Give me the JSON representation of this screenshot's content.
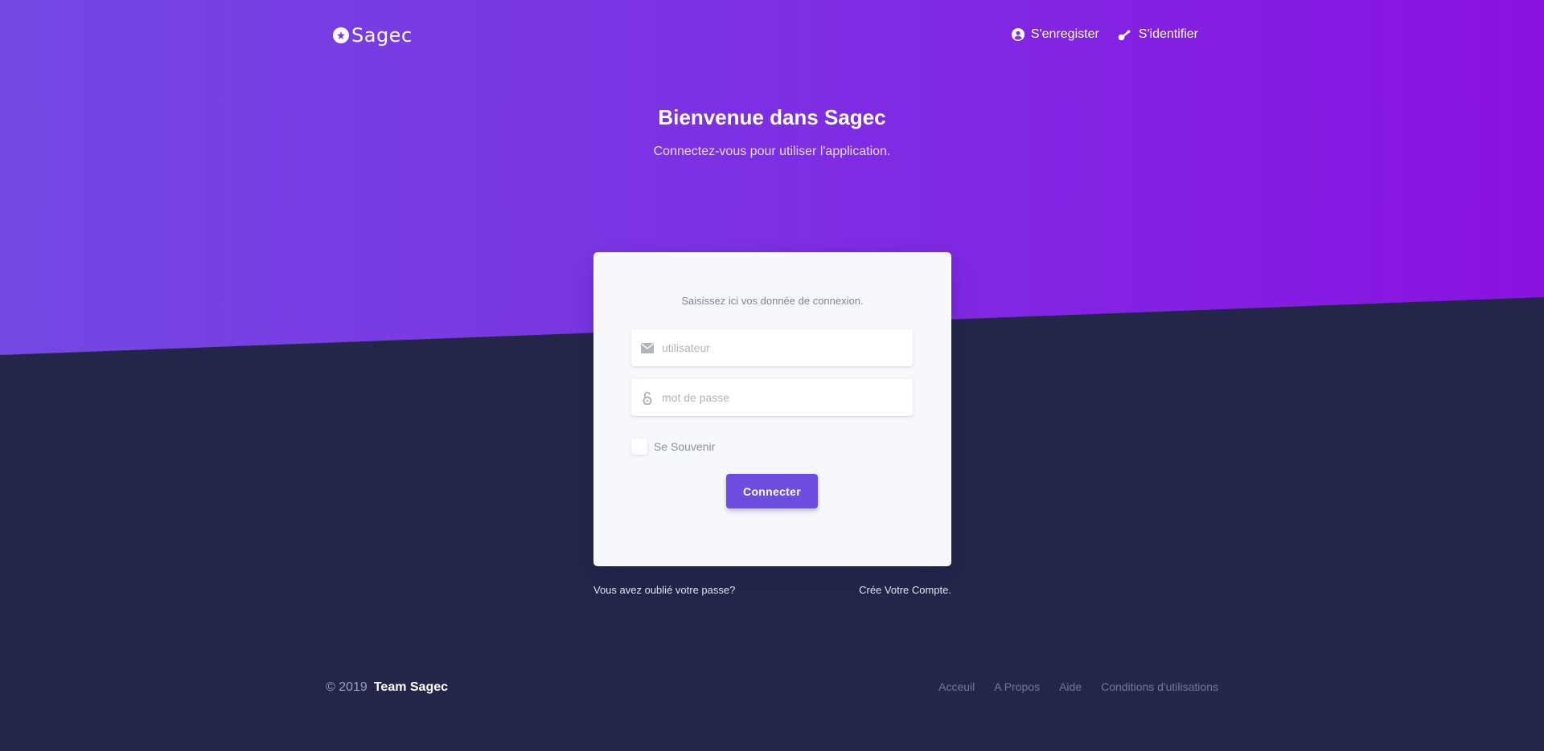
{
  "colors": {
    "hero_start": "#7448e3",
    "hero_end": "#8a12e2",
    "page_background": "#232649",
    "card_background": "#f6f8fb",
    "primary_button": "#6d4de0"
  },
  "navbar": {
    "brand": "Sagec",
    "brand_icon": "star-badge-icon",
    "links": [
      {
        "label": "S'enregister",
        "icon": "user-circle-icon"
      },
      {
        "label": "S'identifier",
        "icon": "key-icon"
      }
    ]
  },
  "hero": {
    "title": "Bienvenue dans Sagec",
    "subtitle": "Connectez-vous pour utiliser l'application."
  },
  "login_card": {
    "hint": "Saisissez ici vos donnée de connexion.",
    "username": {
      "placeholder": "utilisateur",
      "value": "",
      "icon": "envelope-icon"
    },
    "password": {
      "placeholder": "mot de passe",
      "value": "",
      "icon": "lock-open-icon"
    },
    "remember_label": "Se Souvenir",
    "remember_checked": false,
    "submit_label": "Connecter"
  },
  "below_card": {
    "forgot": "Vous avez oublié votre passe?",
    "create": "Crée Votre Compte."
  },
  "footer": {
    "copyright": "© 2019",
    "team": "Team Sagec",
    "links": [
      "Acceuil",
      "A Propos",
      "Aide",
      "Conditions d'utilisations"
    ]
  }
}
